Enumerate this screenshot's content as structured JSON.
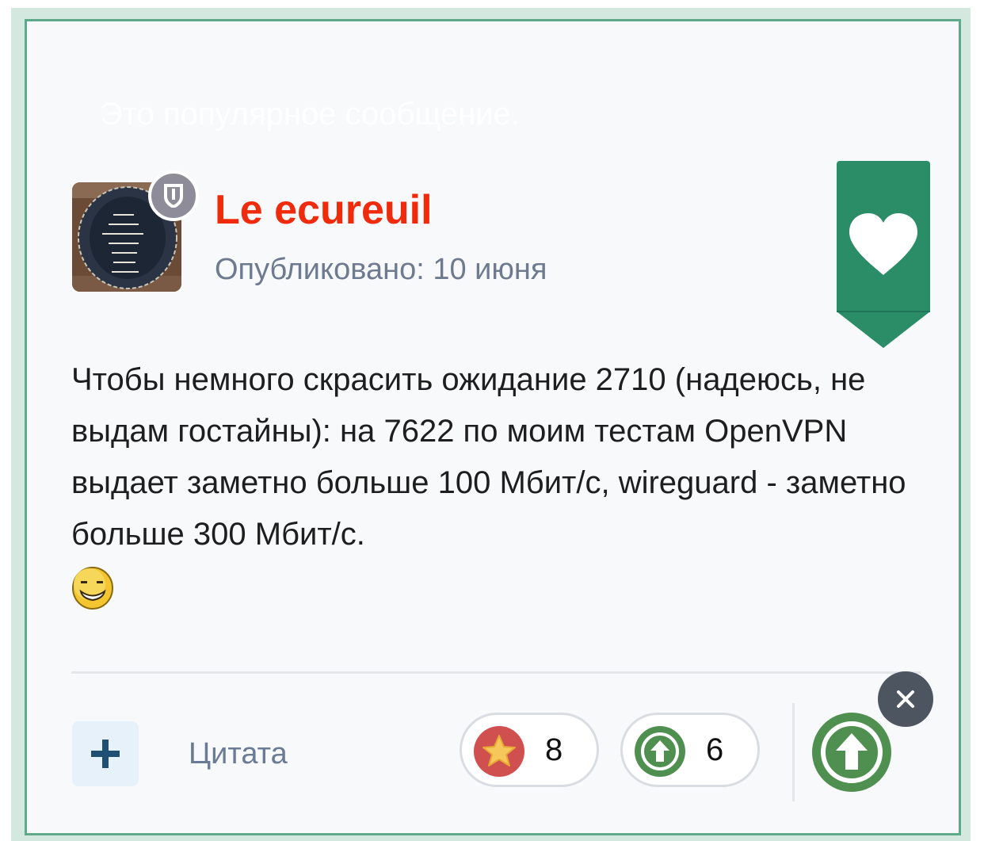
{
  "banner": {
    "popular_text": "Это популярное сообщение."
  },
  "author": {
    "name": "Le ecureuil",
    "avatar_icon": "avatar-image",
    "badge_icon": "shield-icon"
  },
  "post": {
    "published": "Опубликовано: 10 июня",
    "body": "Чтобы немного скрасить ожидание 2710 (надеюсь, не выдам гостайны): на 7622 по моим тестам OpenVPN выдает заметно больше 100 Мбит/с, wireguard - заметно больше 300 Мбит/с.",
    "emoji_icon": "grin-emoji-icon"
  },
  "footer": {
    "quote_label": "Цитата",
    "reactions": [
      {
        "icon": "star-icon",
        "count": "8"
      },
      {
        "icon": "upvote-icon",
        "count": "6"
      }
    ]
  },
  "colors": {
    "author_name": "#ef2b0c",
    "accent_green": "#2b8c68",
    "card_border": "#5ea98a",
    "star_red": "#d0504f",
    "upvote_green": "#4f8f4f",
    "close_dark": "#4c5560"
  }
}
